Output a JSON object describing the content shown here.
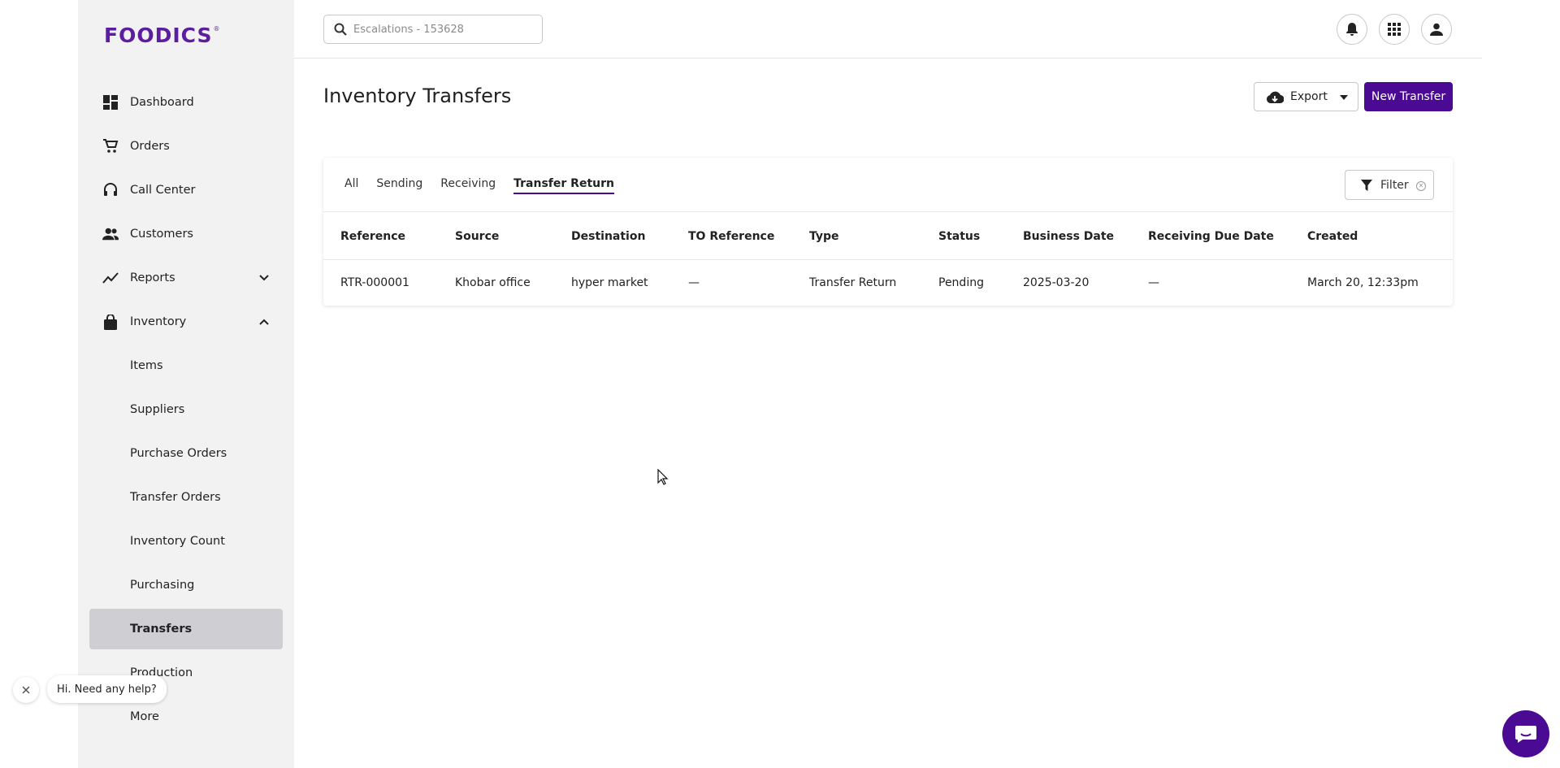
{
  "brand": {
    "logo_text": "FOODICS",
    "logo_mark": "®"
  },
  "header": {
    "search_placeholder": "Escalations - 153628"
  },
  "sidebar": {
    "items": [
      {
        "label": "Dashboard",
        "icon": "dashboard-icon"
      },
      {
        "label": "Orders",
        "icon": "cart-icon"
      },
      {
        "label": "Call Center",
        "icon": "headset-icon"
      },
      {
        "label": "Customers",
        "icon": "users-icon"
      },
      {
        "label": "Reports",
        "icon": "chart-line-icon"
      },
      {
        "label": "Inventory",
        "icon": "bag-icon"
      }
    ],
    "inventory_sub": [
      {
        "label": "Items"
      },
      {
        "label": "Suppliers"
      },
      {
        "label": "Purchase Orders"
      },
      {
        "label": "Transfer Orders"
      },
      {
        "label": "Inventory Count"
      },
      {
        "label": "Purchasing"
      },
      {
        "label": "Transfers"
      },
      {
        "label": "Production"
      },
      {
        "label": "More"
      }
    ]
  },
  "main": {
    "title": "Inventory Transfers",
    "export_label": "Export",
    "new_label": "New Transfer",
    "tabs": [
      {
        "label": "All"
      },
      {
        "label": "Sending"
      },
      {
        "label": "Receiving"
      },
      {
        "label": "Transfer Return"
      }
    ],
    "active_tab": "Transfer Return",
    "filter_label": "Filter",
    "columns": [
      "Reference",
      "Source",
      "Destination",
      "TO Reference",
      "Type",
      "Status",
      "Business Date",
      "Receiving Due Date",
      "Created"
    ],
    "rows": [
      {
        "reference": "RTR-000001",
        "source": "Khobar office",
        "destination": "hyper market",
        "to_reference": "—",
        "type": "Transfer Return",
        "status": "Pending",
        "business_date": "2025-03-20",
        "receiving_due_date": "—",
        "created": "March 20, 12:33pm"
      }
    ]
  },
  "help": {
    "text": "Hi. Need any help?"
  },
  "colors": {
    "brand": "#5a1e9e",
    "primary": "#4b0a93",
    "sidebar_bg": "#f2f2f3",
    "active_bg": "#cfced3"
  }
}
